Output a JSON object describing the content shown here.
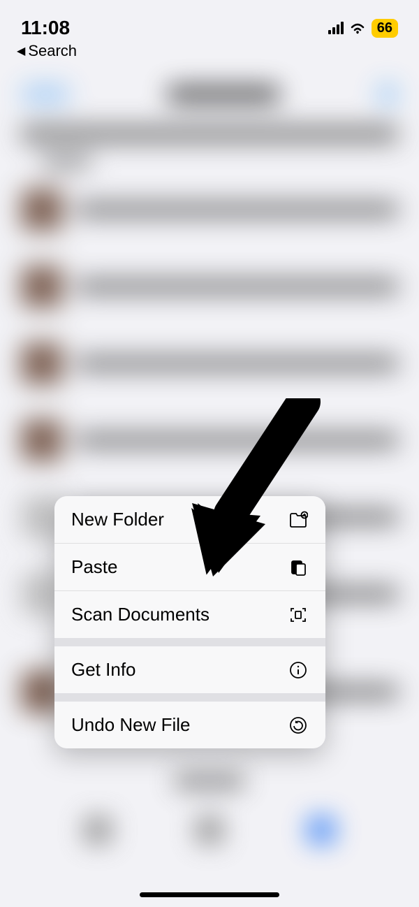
{
  "status": {
    "time": "11:08",
    "battery": "66"
  },
  "backNav": {
    "label": "Search"
  },
  "menu": {
    "groups": [
      [
        {
          "label": "New Folder",
          "icon": "folder-plus-icon"
        },
        {
          "label": "Paste",
          "icon": "paste-icon"
        },
        {
          "label": "Scan Documents",
          "icon": "scan-icon"
        }
      ],
      [
        {
          "label": "Get Info",
          "icon": "info-icon"
        }
      ],
      [
        {
          "label": "Undo New File",
          "icon": "undo-icon"
        }
      ]
    ]
  }
}
